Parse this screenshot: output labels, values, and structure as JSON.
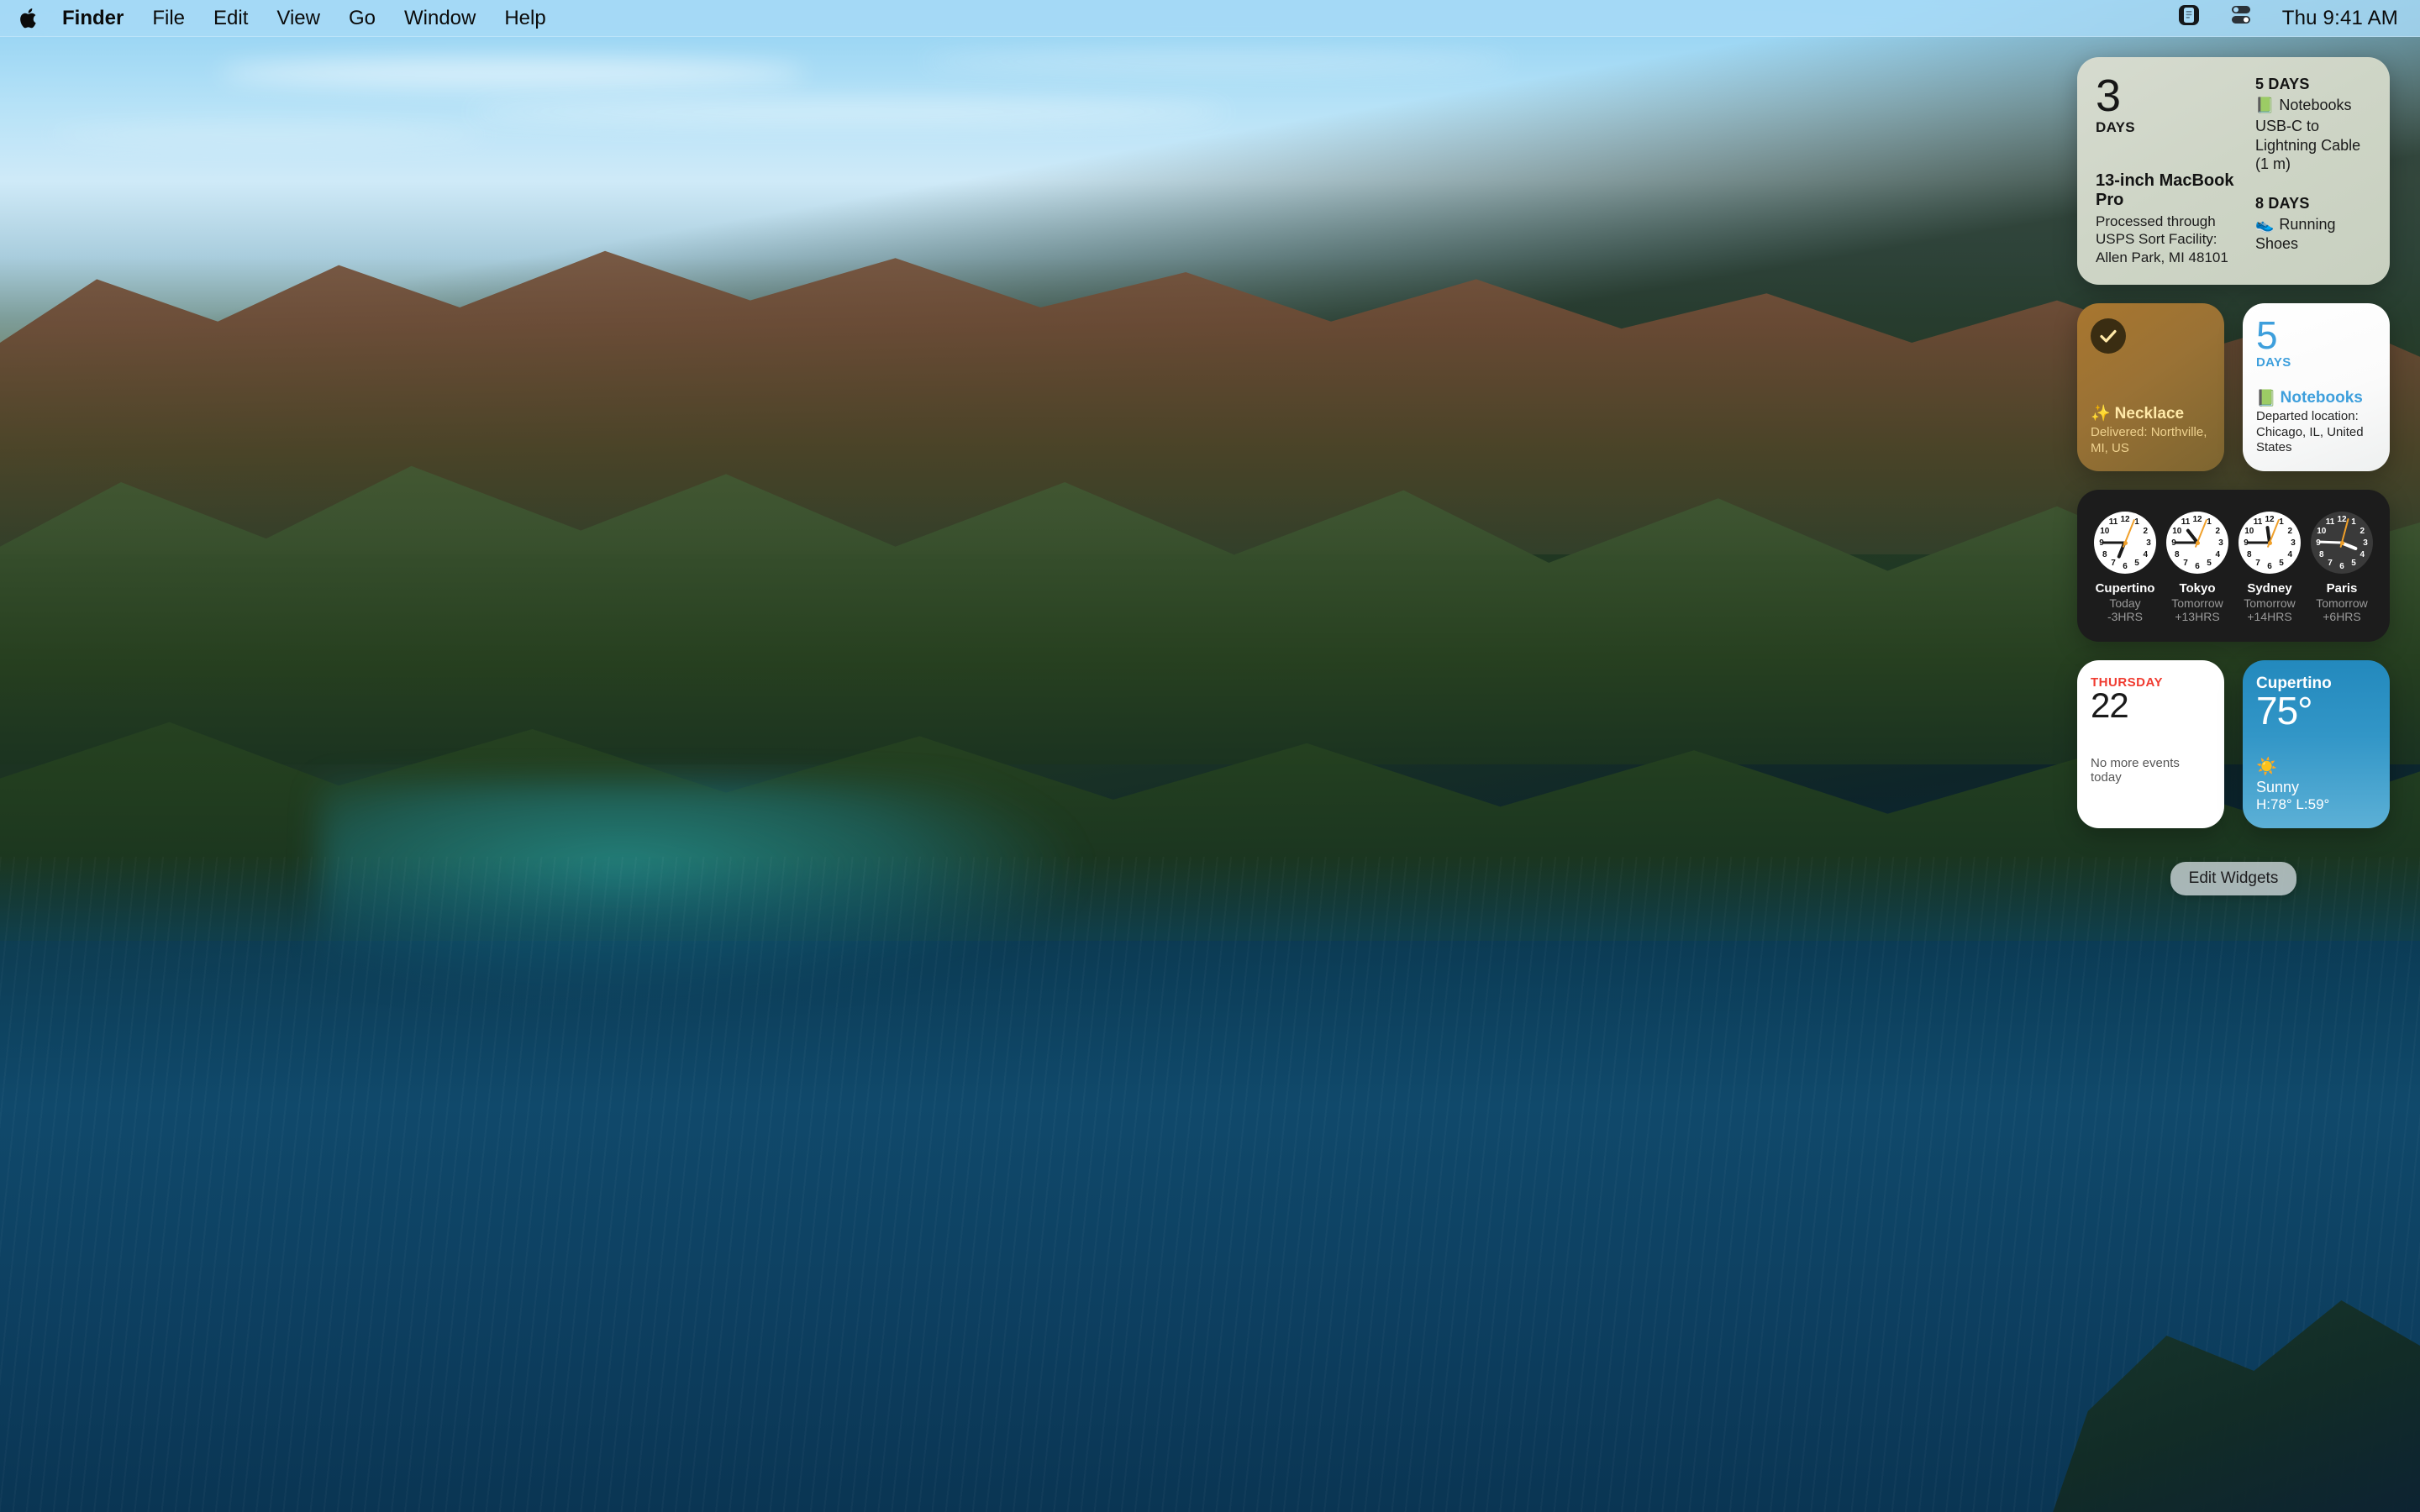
{
  "menubar": {
    "apple_icon": "apple-logo",
    "items": [
      {
        "label": "Finder",
        "bold": true
      },
      {
        "label": "File"
      },
      {
        "label": "Edit"
      },
      {
        "label": "View"
      },
      {
        "label": "Go"
      },
      {
        "label": "Window"
      },
      {
        "label": "Help"
      }
    ],
    "status_icons": [
      "notification-center-icon",
      "control-center-icon"
    ],
    "clock": "Thu 9:41 AM"
  },
  "notification_center": {
    "parcel_large": {
      "days_number": "3",
      "days_label": "DAYS",
      "title": "13-inch MacBook Pro",
      "status": "Processed through USPS Sort Facility: Allen Park, MI 48101",
      "others": [
        {
          "days": "5 DAYS",
          "emoji": "📗",
          "name": "Notebooks",
          "detail": "USB-C to Lightning Cable (1 m)"
        },
        {
          "days": "8 DAYS",
          "emoji": "👟",
          "name": "Running Shoes",
          "detail": ""
        }
      ]
    },
    "necklace": {
      "emoji": "✨",
      "title": "Necklace",
      "status": "Delivered: Northville, MI, US",
      "delivered_icon": "checkmark-icon",
      "accent": "#a8762f"
    },
    "notebooks": {
      "days_number": "5",
      "days_label": "DAYS",
      "emoji": "📗",
      "title": "Notebooks",
      "status": "Departed location: Chicago, IL, United States",
      "accent": "#3e9fdc"
    },
    "world_clock": {
      "clocks": [
        {
          "city": "Cupertino",
          "day": "Today",
          "offset": "-3HRS",
          "theme": "light",
          "hour_deg": 202,
          "minute_deg": 270,
          "second_deg": 22
        },
        {
          "city": "Tokyo",
          "day": "Tomorrow",
          "offset": "+13HRS",
          "theme": "light",
          "hour_deg": 322,
          "minute_deg": 270,
          "second_deg": 22
        },
        {
          "city": "Sydney",
          "day": "Tomorrow",
          "offset": "+14HRS",
          "theme": "light",
          "hour_deg": 352,
          "minute_deg": 270,
          "second_deg": 22
        },
        {
          "city": "Paris",
          "day": "Tomorrow",
          "offset": "+6HRS",
          "theme": "dark",
          "hour_deg": 112,
          "minute_deg": 272,
          "second_deg": 15
        }
      ],
      "hour_marks": [
        "12",
        "1",
        "2",
        "3",
        "4",
        "5",
        "6",
        "7",
        "8",
        "9",
        "10",
        "11"
      ],
      "accent": "#f0a02a"
    },
    "calendar": {
      "day_of_week": "THURSDAY",
      "date": "22",
      "empty_message": "No more events today",
      "accent": "#f03b30"
    },
    "weather": {
      "city": "Cupertino",
      "temperature": "75°",
      "icon": "☀️",
      "condition": "Sunny",
      "high_low": "H:78° L:59°",
      "accent": "#3296c7"
    },
    "edit_widgets_label": "Edit Widgets"
  }
}
